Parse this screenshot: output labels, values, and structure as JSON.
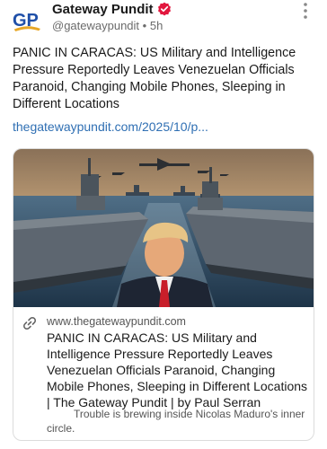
{
  "post": {
    "author_name": "Gateway Pundit",
    "handle": "@gatewaypundit",
    "separator": "•",
    "time": "5h",
    "body": "PANIC IN CARACAS: US Military and Intelligence Pressure Reportedly Leaves Venezuelan Officials Paranoid, Changing Mobile Phones, Sleeping in Different Locations",
    "link_text": "thegatewaypundit.com/2025/10/p..."
  },
  "avatar": {
    "letters": "GP"
  },
  "card": {
    "domain": "www.thegatewaypundit.com",
    "title": "PANIC IN CARACAS: US Military and Intelligence Pressure Reportedly Leaves Venezuelan Officials Paranoid, Changing Mobile Phones, Sleeping in Different Locations | The Gateway Pundit | by Paul Serran",
    "description": "Trouble is brewing inside Nicolas Maduro's inner circle."
  },
  "icons": {
    "verified": "verified-badge-icon",
    "more": "more-options-icon",
    "link": "link-icon"
  },
  "colors": {
    "link": "#2f6fb3",
    "verified": "#e2173e",
    "brand_blue": "#1f4fa8",
    "brand_gold": "#e7a625"
  }
}
